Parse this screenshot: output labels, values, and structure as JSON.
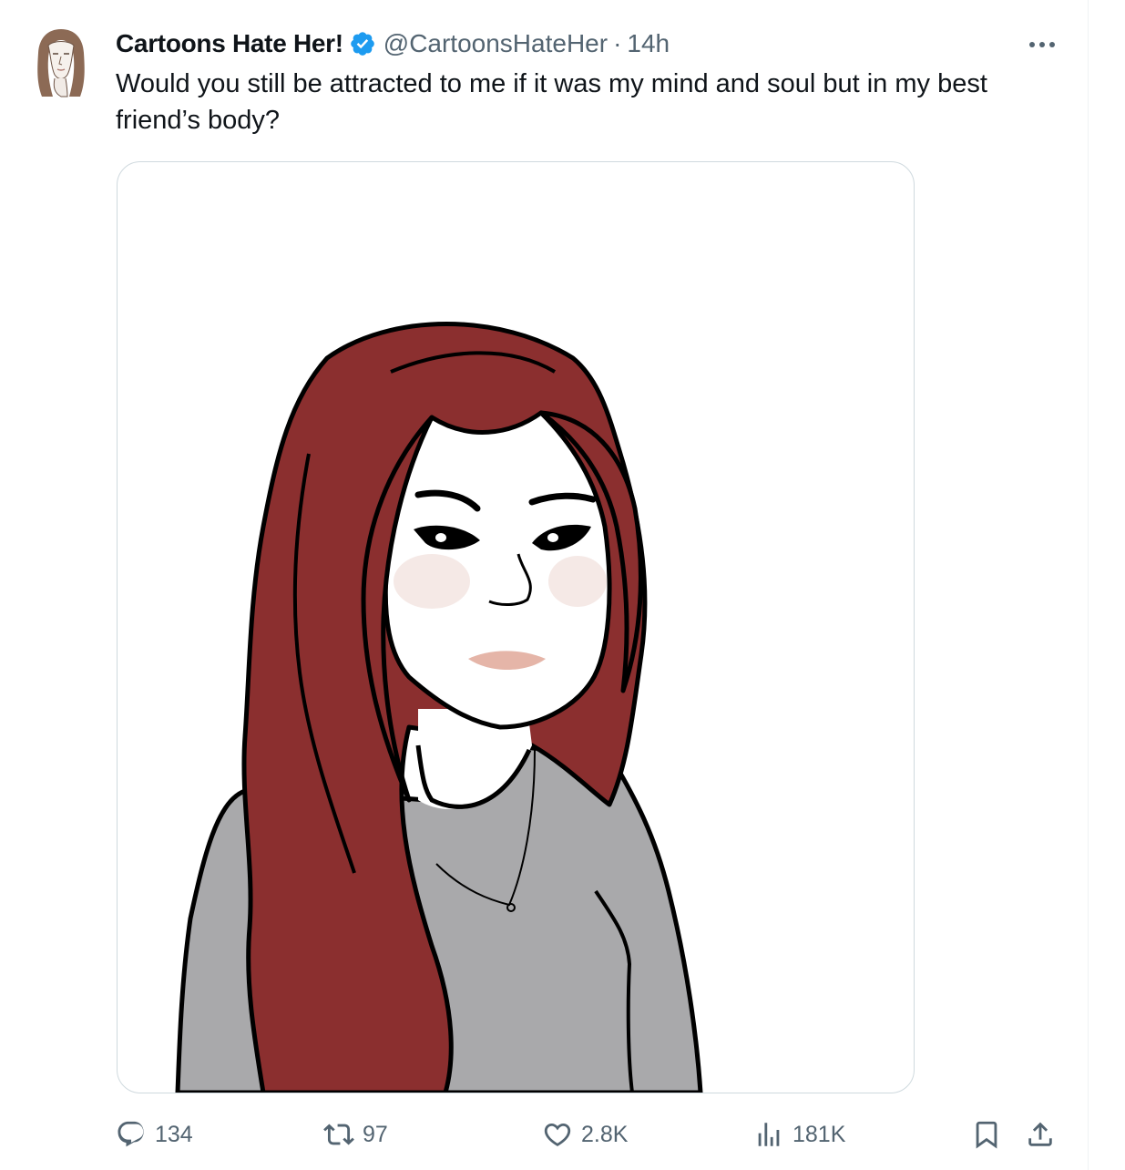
{
  "tweet": {
    "display_name": "Cartoons Hate Her!",
    "handle": "@CartoonsHateHer",
    "separator": "·",
    "time": "14h",
    "text": "Would you still be attracted to me if it was my mind and soul but in my best friend’s body?",
    "verified": true
  },
  "actions": {
    "replies": "134",
    "reposts": "97",
    "likes": "2.8K",
    "views": "181K"
  },
  "icons": {
    "verified": "verified-badge-icon",
    "more": "more-icon",
    "reply": "reply-icon",
    "repost": "repost-icon",
    "like": "heart-icon",
    "views": "views-icon",
    "bookmark": "bookmark-icon",
    "share": "share-icon"
  },
  "colors": {
    "verified_blue": "#1d9bf0",
    "secondary_text": "#536471",
    "hair": "#8b2f2f",
    "sweater": "#a9a9ab"
  }
}
